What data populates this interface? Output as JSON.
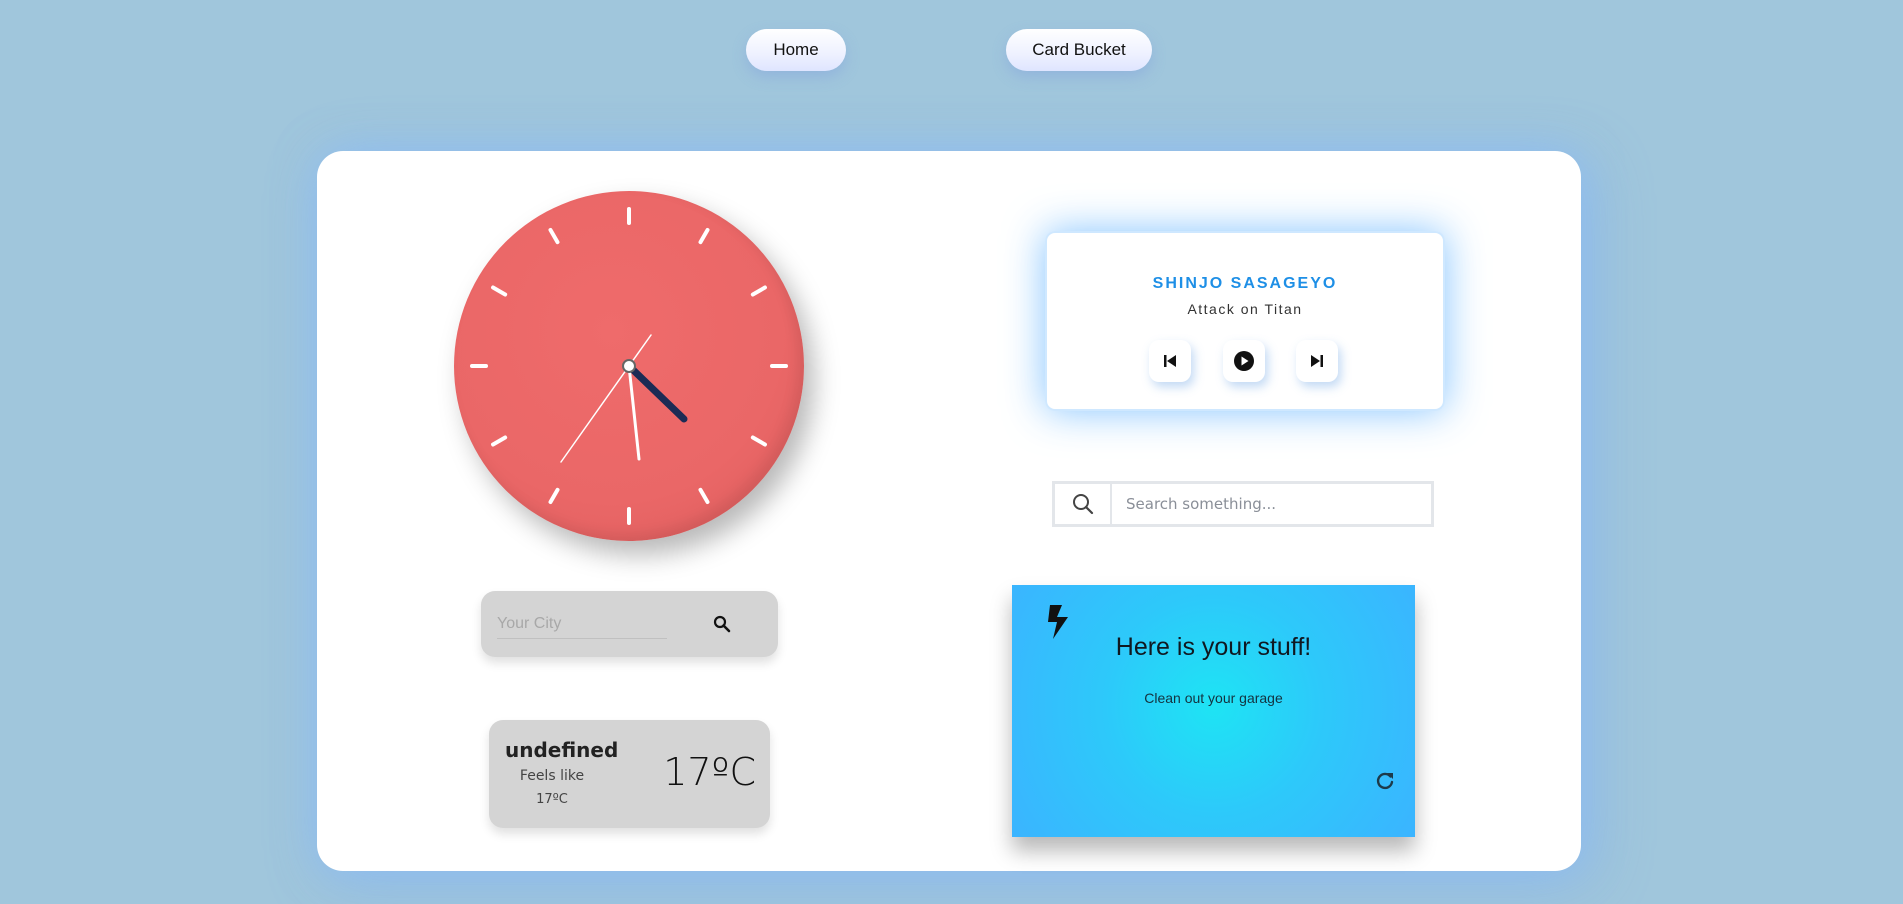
{
  "nav": {
    "home_label": "Home",
    "card_bucket_label": "Card Bucket"
  },
  "clock": {
    "hour_markers": 12,
    "hour_hand_color": "#1c2b55",
    "minute_hand_color": "#ffffff",
    "second_hand_color": "#ffffff",
    "face_color": "#ea6767"
  },
  "music": {
    "title": "SHINJO SASAGEYO",
    "artist": "Attack on Titan",
    "controls": [
      "previous-icon",
      "play-icon",
      "next-icon"
    ],
    "title_color": "#1e8fe6"
  },
  "search": {
    "placeholder": "Search something..."
  },
  "city": {
    "placeholder": "Your City"
  },
  "weather": {
    "city": "undefined",
    "feels_like_label": "Feels like",
    "feels_like_value": "17ºC",
    "temperature": "17ºC"
  },
  "stuff_card": {
    "title": "Here is your stuff!",
    "subtitle": "Clean out your garage",
    "icon": "lightning-icon",
    "action_icon": "refresh-icon"
  }
}
